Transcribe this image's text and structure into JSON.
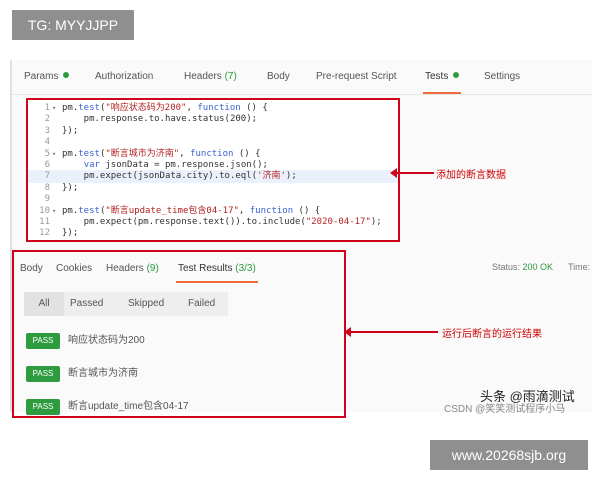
{
  "tg_label": "TG: MYYJJPP",
  "request_tabs": [
    {
      "label": "Params",
      "count": "",
      "dot": true,
      "active": false
    },
    {
      "label": "Authorization",
      "count": "",
      "dot": false,
      "active": false
    },
    {
      "label": "Headers",
      "count": "(7)",
      "dot": false,
      "active": false
    },
    {
      "label": "Body",
      "count": "",
      "dot": false,
      "active": false
    },
    {
      "label": "Pre-request Script",
      "count": "",
      "dot": false,
      "active": false
    },
    {
      "label": "Tests",
      "count": "",
      "dot": true,
      "active": true
    },
    {
      "label": "Settings",
      "count": "",
      "dot": false,
      "active": false
    }
  ],
  "code_lines": [
    {
      "n": "1",
      "fold": "▾",
      "hl": false,
      "parts": [
        [
          "",
          "pm."
        ],
        [
          "kw",
          "test"
        ],
        [
          "",
          "("
        ],
        [
          "str",
          "\"响应状态码为200\""
        ],
        [
          "",
          ", "
        ],
        [
          "kw",
          "function"
        ],
        [
          "",
          " () {"
        ]
      ]
    },
    {
      "n": "2",
      "fold": "",
      "hl": false,
      "parts": [
        [
          "",
          "    pm.response.to.have.status(200);"
        ]
      ]
    },
    {
      "n": "3",
      "fold": "",
      "hl": false,
      "parts": [
        [
          "",
          "});"
        ]
      ]
    },
    {
      "n": "4",
      "fold": "",
      "hl": false,
      "parts": []
    },
    {
      "n": "5",
      "fold": "▾",
      "hl": false,
      "parts": [
        [
          "",
          "pm."
        ],
        [
          "kw",
          "test"
        ],
        [
          "",
          "("
        ],
        [
          "str",
          "\"断言城市为济南\""
        ],
        [
          "",
          ", "
        ],
        [
          "kw",
          "function"
        ],
        [
          "",
          " () {"
        ]
      ]
    },
    {
      "n": "6",
      "fold": "",
      "hl": false,
      "parts": [
        [
          "",
          "    "
        ],
        [
          "kw",
          "var"
        ],
        [
          "",
          " jsonData = pm.response.json();"
        ]
      ]
    },
    {
      "n": "7",
      "fold": "",
      "hl": true,
      "parts": [
        [
          "",
          "    pm.expect(jsonData.city).to.eql("
        ],
        [
          "str",
          "'济南'"
        ],
        [
          "",
          ");"
        ]
      ]
    },
    {
      "n": "8",
      "fold": "",
      "hl": false,
      "parts": [
        [
          "",
          "});"
        ]
      ]
    },
    {
      "n": "9",
      "fold": "",
      "hl": false,
      "parts": []
    },
    {
      "n": "10",
      "fold": "▾",
      "hl": false,
      "parts": [
        [
          "",
          "pm."
        ],
        [
          "kw",
          "test"
        ],
        [
          "",
          "("
        ],
        [
          "str",
          "\"断言update_time包含04-17\""
        ],
        [
          "",
          ", "
        ],
        [
          "kw",
          "function"
        ],
        [
          "",
          " () {"
        ]
      ]
    },
    {
      "n": "11",
      "fold": "",
      "hl": false,
      "parts": [
        [
          "",
          "    pm.expect(pm.response.text()).to.include("
        ],
        [
          "str",
          "\"2020-04-17\""
        ],
        [
          "",
          ");"
        ]
      ]
    },
    {
      "n": "12",
      "fold": "",
      "hl": false,
      "parts": [
        [
          "",
          "});"
        ]
      ]
    }
  ],
  "annotation_add": "添加的断言数据",
  "response_tabs": [
    {
      "label": "Body",
      "count": "",
      "active": false
    },
    {
      "label": "Cookies",
      "count": "",
      "active": false
    },
    {
      "label": "Headers",
      "count": "(9)",
      "active": false
    },
    {
      "label": "Test Results",
      "count": "(3/3)",
      "active": true
    }
  ],
  "status": {
    "label": "Status:",
    "value": "200 OK",
    "time_label": "Time:"
  },
  "filters": [
    {
      "label": "All",
      "active": true
    },
    {
      "label": "Passed",
      "active": false
    },
    {
      "label": "Skipped",
      "active": false
    },
    {
      "label": "Failed",
      "active": false
    }
  ],
  "results": [
    {
      "status": "PASS",
      "name": "响应状态码为200"
    },
    {
      "status": "PASS",
      "name": "断言城市为济南"
    },
    {
      "status": "PASS",
      "name": "断言update_time包含04-17"
    }
  ],
  "annotation_results": "运行后断言的运行结果",
  "watermark_main": "头条 @雨滴测试",
  "watermark_csdn": "CSDN @笑笑测试程序小马",
  "site_label": "www.20268sjb.org",
  "colors": {
    "pass": "#2e9b3e",
    "annotation": "#d0021b",
    "active_tab": "#f26b3a",
    "keyword": "#3a5fcd",
    "string": "#b22222"
  }
}
